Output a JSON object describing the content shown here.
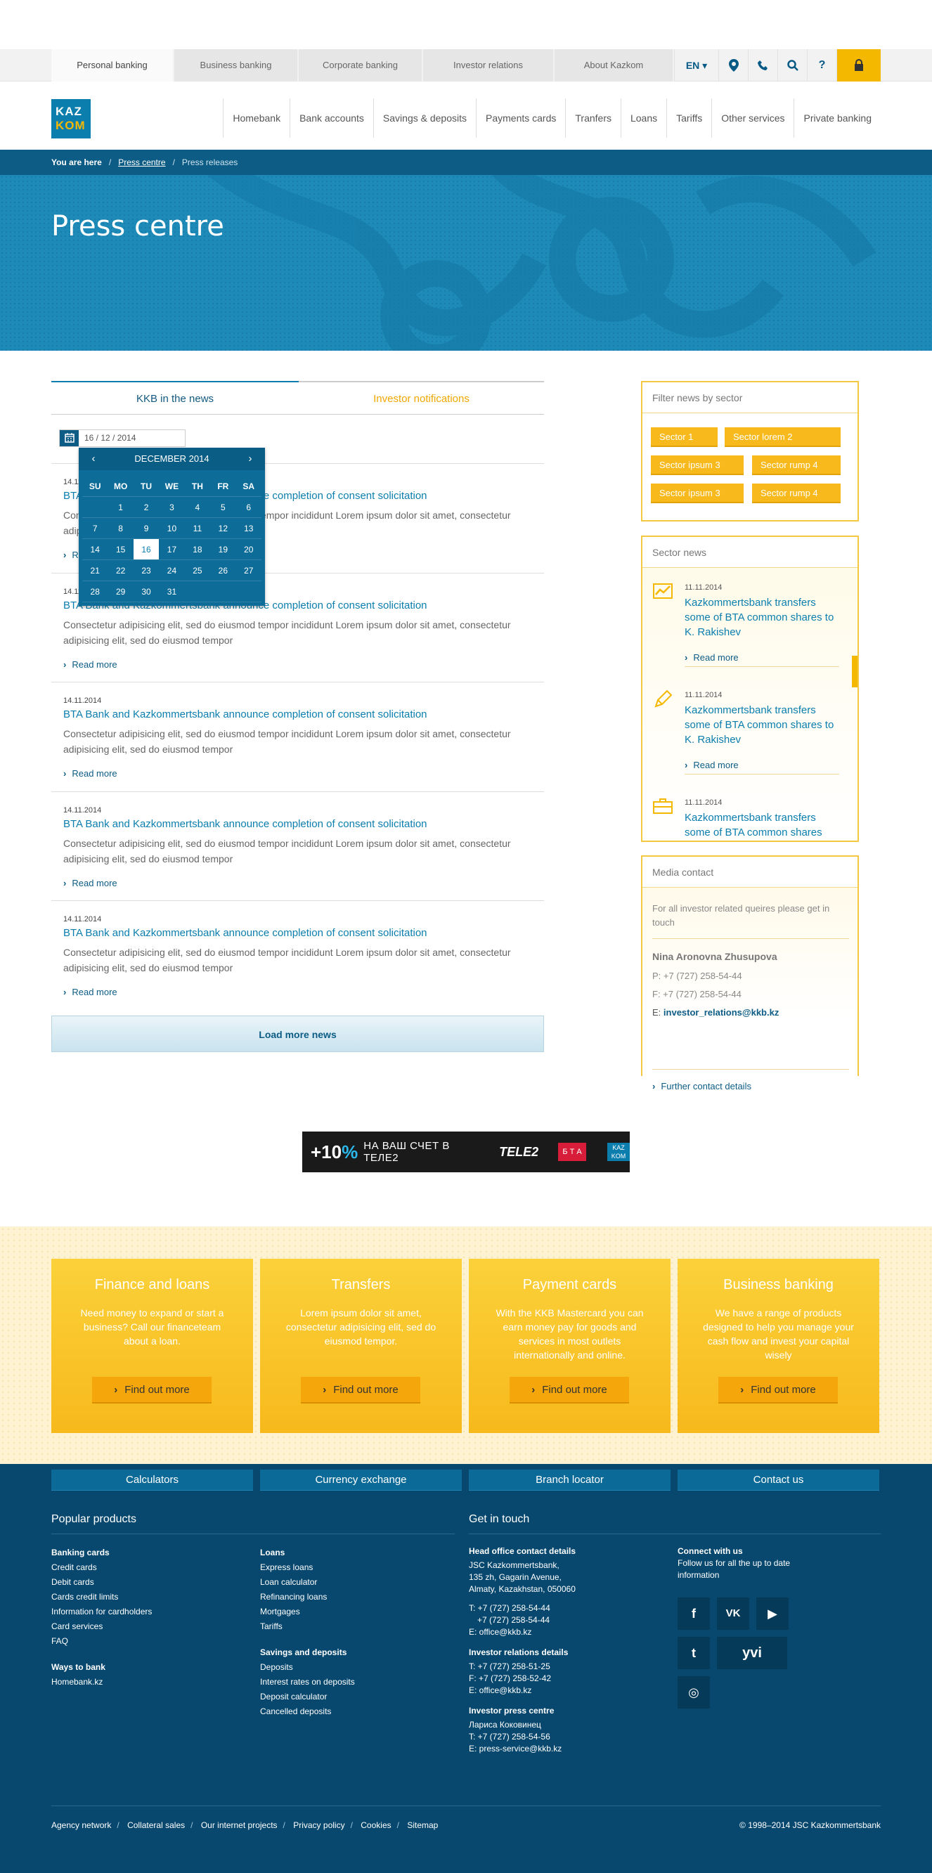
{
  "top_tabs": [
    "Personal banking",
    "Business banking",
    "Corporate banking",
    "Investor relations",
    "About Kazkom"
  ],
  "lang": "EN ▾",
  "logo": {
    "line1": "KAZ",
    "line2": "KOM"
  },
  "main_nav": [
    "Homebank",
    "Bank accounts",
    "Savings & deposits",
    "Payments cards",
    "Tranfers",
    "Loans",
    "Tariffs",
    "Other services",
    "Private banking"
  ],
  "breadcrumb": {
    "you_are_here": "You are here",
    "sep": "/",
    "link": "Press centre",
    "current": "Press releases"
  },
  "hero_title": "Press centre",
  "news_tabs": {
    "active": "KKB in the news",
    "other": "Investor notifications"
  },
  "date_value": "16 / 12 / 2014",
  "calendar": {
    "month": "DECEMBER 2014",
    "prev": "‹",
    "next": "›",
    "days": [
      "SU",
      "MO",
      "TU",
      "WE",
      "TH",
      "FR",
      "SA"
    ],
    "weeks": [
      [
        "",
        "1",
        "2",
        "3",
        "4",
        "5",
        "6"
      ],
      [
        "7",
        "8",
        "9",
        "10",
        "11",
        "12",
        "13"
      ],
      [
        "14",
        "15",
        "16",
        "17",
        "18",
        "19",
        "20"
      ],
      [
        "21",
        "22",
        "23",
        "24",
        "25",
        "26",
        "27"
      ],
      [
        "28",
        "29",
        "30",
        "31",
        "",
        "",
        ""
      ]
    ],
    "selected": "16"
  },
  "news": [
    {
      "date": "14.11.2014",
      "title": "BTA Bank and Kazkommertsbank announce completion of consent solicitation",
      "body": "Consectetur adipisicing elit, sed do eiusmod tempor incididunt Lorem ipsum dolor sit amet, consectetur adipisicing elit, sed do eiusmod tempor",
      "more": "Read more"
    },
    {
      "date": "14.11.2014",
      "title": "BTA Bank and Kazkommertsbank announce completion of consent solicitation",
      "body": "Consectetur adipisicing elit, sed do eiusmod tempor incididunt Lorem ipsum dolor sit amet, consectetur adipisicing elit, sed do eiusmod tempor",
      "more": "Read more"
    },
    {
      "date": "14.11.2014",
      "title": "BTA Bank and Kazkommertsbank announce completion of consent solicitation",
      "body": "Consectetur adipisicing elit, sed do eiusmod tempor incididunt Lorem ipsum dolor sit amet, consectetur adipisicing elit, sed do eiusmod tempor",
      "more": "Read more"
    },
    {
      "date": "14.11.2014",
      "title": "BTA Bank and Kazkommertsbank announce completion of consent solicitation",
      "body": "Consectetur adipisicing elit, sed do eiusmod tempor incididunt Lorem ipsum dolor sit amet, consectetur adipisicing elit, sed do eiusmod tempor",
      "more": "Read more"
    },
    {
      "date": "14.11.2014",
      "title": "BTA Bank and Kazkommertsbank announce completion of consent solicitation",
      "body": "Consectetur adipisicing elit, sed do eiusmod tempor incididunt Lorem ipsum dolor sit amet, consectetur adipisicing elit, sed do eiusmod tempor",
      "more": "Read more"
    }
  ],
  "load_more": "Load more news",
  "filter": {
    "title": "Filter news by sector",
    "sectors": [
      "Sector 1",
      "Sector lorem 2",
      "Sector ipsum 3",
      "Sector rump 4",
      "Sector ipsum 3",
      "Sector rump 4"
    ]
  },
  "sector_news": {
    "title": "Sector news",
    "items": [
      {
        "date": "11.11.2014",
        "title": "Kazkommertsbank transfers some of BTA common shares to K. Rakishev",
        "more": "Read more",
        "icon": "chart-icon"
      },
      {
        "date": "11.11.2014",
        "title": "Kazkommertsbank transfers some of BTA common shares to K. Rakishev",
        "more": "Read more",
        "icon": "pencil-icon"
      },
      {
        "date": "11.11.2014",
        "title": "Kazkommertsbank transfers some of BTA common shares",
        "more": "",
        "icon": "briefcase-icon"
      }
    ]
  },
  "media_contact": {
    "title": "Media contact",
    "intro": "For all investor related queires please get in touch",
    "name": "Nina Aronovna Zhusupova",
    "phone": "P: +7 (727) 258-54-44",
    "fax": "F: +7 (727) 258-54-44",
    "email_label": "E:",
    "email": "investor_relations@kkb.kz",
    "more": "Further contact details"
  },
  "banner": {
    "pct_plus": "+10",
    "pct_sign": "%",
    "text": "НА ВАШ СЧЕТ В ТЕЛЕ2",
    "brand": "TELE2",
    "bta": "Б Т А",
    "kk": "KAZ KOM"
  },
  "promo": [
    {
      "title": "Finance and loans",
      "text": "Need money to expand or start a business? Call our financeteam about a loan.",
      "btn": "Find out more"
    },
    {
      "title": "Transfers",
      "text": "Lorem ipsum dolor sit amet, consectetur adipisicing elit, sed do eiusmod tempor.",
      "btn": "Find out more"
    },
    {
      "title": "Payment cards",
      "text": "With the KKB Mastercard you can earn money pay for goods and services in most outlets internationally and online.",
      "btn": "Find out more"
    },
    {
      "title": "Business banking",
      "text": "We have a range of products designed to help you manage your cash flow and invest your capital wisely",
      "btn": "Find out more"
    }
  ],
  "footer": {
    "tools": [
      "Calculators",
      "Currency exchange",
      "Branch locator",
      "Contact us"
    ],
    "popular": "Popular products",
    "touch": "Get in touch",
    "col1a": {
      "title": "Banking cards",
      "links": [
        "Credit cards",
        "Debit cards",
        "Cards credit limits",
        "Information for cardholders",
        "Card services",
        "FAQ"
      ]
    },
    "col1b": {
      "title": "Ways to bank",
      "links": [
        "Homebank.kz"
      ]
    },
    "col2a": {
      "title": "Loans",
      "links": [
        "Express loans",
        "Loan calculator",
        "Refinancing loans",
        "Mortgages",
        "Tariffs"
      ]
    },
    "col2b": {
      "title": "Savings and deposits",
      "links": [
        "Deposits",
        "Interest rates on deposits",
        "Deposit calculator",
        "Cancelled deposits"
      ]
    },
    "head_office": {
      "title": "Head office contact details",
      "l1": "JSC Kazkommertsbank,",
      "l2": "135 zh, Gagarin Avenue,",
      "l3": "Almaty, Kazakhstan, 050060",
      "t1": "T: +7 (727) 258-54-44",
      "t2": "+7 (727) 258-54-44",
      "e": "E: office@kkb.kz"
    },
    "ir": {
      "title": "Investor relations details",
      "t": "T: +7 (727) 258-51-25",
      "f": "F: +7 (727) 258-52-42",
      "e": "E: office@kkb.kz"
    },
    "press": {
      "title": "Investor press centre",
      "name": "Лариса Коковинец",
      "t": "T: +7 (727) 258-54-56",
      "e": "E: press-service@kkb.kz"
    },
    "connect": {
      "title": "Connect with us",
      "text": "Follow us for all the up to date information"
    },
    "social": {
      "facebook": "f",
      "vk": "VK",
      "youtube": "▶",
      "twitter": "t",
      "yvi": "yvi",
      "instagram": "◎"
    },
    "bottom_links": [
      "Agency network",
      "Collateral sales",
      "Our internet projects",
      "Privacy policy",
      "Cookies",
      "Sitemap"
    ],
    "copyright": "© 1998–2014 JSC Kazkommertsbank"
  }
}
